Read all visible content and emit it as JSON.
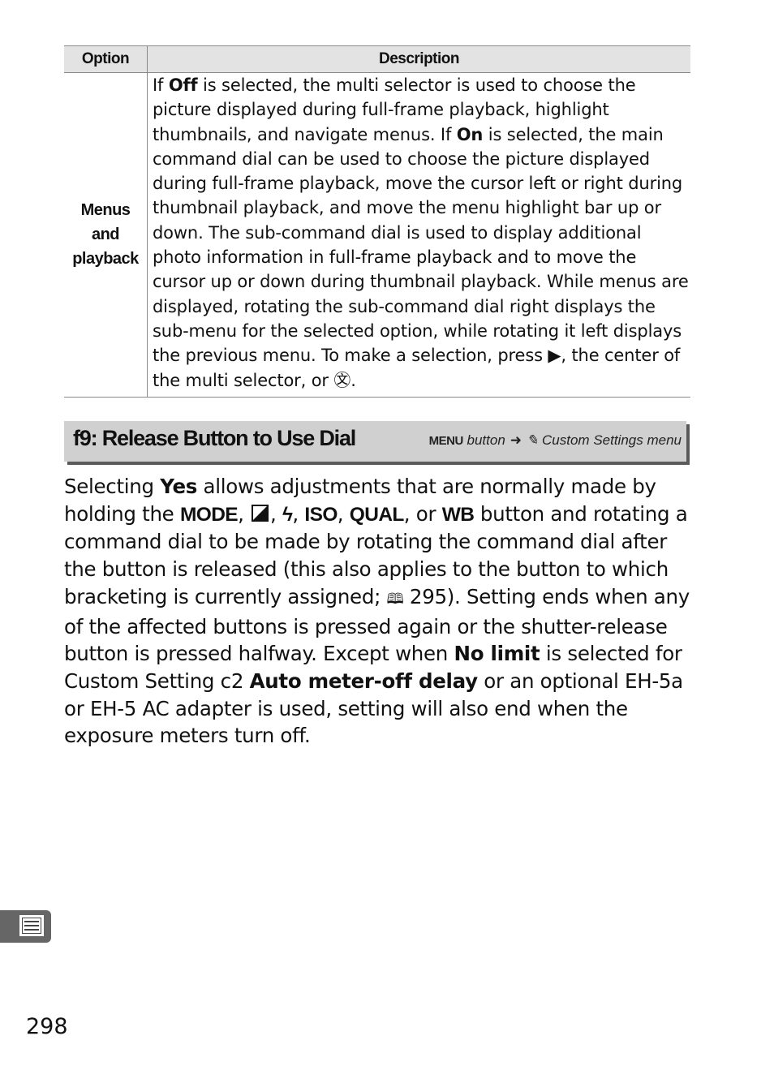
{
  "table": {
    "headers": [
      "Option",
      "Description"
    ],
    "rows": [
      {
        "option_lines": [
          "Menus",
          "and",
          "playback"
        ],
        "description_parts": {
          "p1": "If ",
          "b1": "Off",
          "p2": " is selected, the multi selector is used to choose the picture displayed during full-frame playback, highlight thumbnails, and navigate menus.  If ",
          "b2": "On",
          "p3": " is selected, the main command dial can be used to choose the picture displayed during full-frame playback, move the cursor left or right during thumbnail playback, and move the menu highlight bar up or down.  The sub-command dial is used to display additional photo information in full-frame playback and to move the cursor up or down during thumbnail playback.  While menus are displayed, rotating the sub-command dial right displays the sub-menu for the selected option, while rotating it left displays the previous menu.  To make a selection, press ",
          "sym1": "▶",
          "p4": ", the center of the multi selector, or ",
          "sym2": "㉆",
          "p5": "."
        }
      }
    ]
  },
  "section": {
    "title": "f9: Release Button to Use Dial",
    "path_menu": "MENU",
    "path_button": " button",
    "path_arrow": "➜",
    "path_icon": "✎",
    "path_menu_name": " Custom Settings menu"
  },
  "body": {
    "t1": "Selecting ",
    "b_yes": "Yes",
    "t2": " allows adjustments that are normally made by holding the ",
    "k_mode": "MODE",
    "t3": ", ",
    "t4": ",  ",
    "k_flash": "ϟ",
    "t5": ", ",
    "k_iso": "ISO",
    "t6": ", ",
    "k_qual": "QUAL",
    "t7": ", or ",
    "k_wb": "WB",
    "t8": " button and rotating a command dial to be made by rotating the command dial after the button is released (this also applies to the button to which bracketing is currently assigned; ",
    "ref_icon": "🕮",
    "ref_page": " 295).  Setting ends when any of the affected buttons is pressed again or the shutter-release button is pressed halfway.  Except when ",
    "b_nolimit": "No limit",
    "t9": " is selected for Custom Setting c2 ",
    "b_meter": "Auto meter-off delay",
    "t10": " or an optional EH-5a or EH-5 AC adapter is used, setting will also end when the exposure meters turn off."
  },
  "side_tab": {
    "icon": "menu-list-icon"
  },
  "page_number": "298"
}
